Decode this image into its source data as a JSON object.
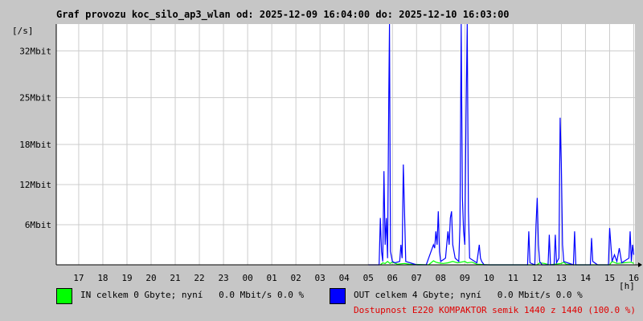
{
  "title": "Graf provozu koc_silo_ap3_wlan od: 2025-12-09 16:04:00 do: 2025-12-10 16:03:00",
  "chart_data": {
    "type": "line",
    "ylabel": "[/s]",
    "xlabel": "[h]",
    "ylim": [
      0,
      36
    ],
    "y_ticks": [
      {
        "value": 6,
        "label": "6Mbit"
      },
      {
        "value": 12,
        "label": "12Mbit"
      },
      {
        "value": 18,
        "label": "18Mbit"
      },
      {
        "value": 25,
        "label": "25Mbit"
      },
      {
        "value": 32,
        "label": "32Mbit"
      }
    ],
    "x_ticks": [
      "17",
      "18",
      "19",
      "20",
      "21",
      "22",
      "23",
      "00",
      "01",
      "02",
      "03",
      "04",
      "05",
      "06",
      "07",
      "08",
      "09",
      "10",
      "11",
      "12",
      "13",
      "14",
      "15",
      "16"
    ],
    "x_range_hours": [
      16.07,
      40.05
    ],
    "grid": true,
    "series": [
      {
        "name": "IN",
        "color": "#00ff00",
        "points": [
          [
            29.5,
            0
          ],
          [
            29.6,
            0.3
          ],
          [
            29.7,
            0.2
          ],
          [
            29.8,
            0.5
          ],
          [
            29.9,
            0.2
          ],
          [
            30.0,
            0.4
          ],
          [
            30.2,
            0.1
          ],
          [
            30.5,
            0.2
          ],
          [
            30.7,
            0.1
          ],
          [
            31.5,
            0
          ],
          [
            31.6,
            0.3
          ],
          [
            31.7,
            0.6
          ],
          [
            31.8,
            0.4
          ],
          [
            31.9,
            0.3
          ],
          [
            32.1,
            0.2
          ],
          [
            32.3,
            0.3
          ],
          [
            32.5,
            0.5
          ],
          [
            32.7,
            0.3
          ],
          [
            33.0,
            0.5
          ],
          [
            33.1,
            0.3
          ],
          [
            33.3,
            0.4
          ],
          [
            33.5,
            0.1
          ],
          [
            34.0,
            0
          ],
          [
            36.0,
            0
          ],
          [
            36.1,
            0.3
          ],
          [
            36.3,
            0.2
          ],
          [
            36.5,
            0
          ],
          [
            37.0,
            0.2
          ],
          [
            37.1,
            0.4
          ],
          [
            37.2,
            0.1
          ],
          [
            37.5,
            0
          ],
          [
            39.0,
            0
          ],
          [
            39.1,
            0.5
          ],
          [
            39.3,
            0.2
          ],
          [
            39.6,
            0.3
          ],
          [
            39.9,
            0.4
          ],
          [
            40.0,
            0.2
          ]
        ]
      },
      {
        "name": "OUT",
        "color": "#0000ff",
        "points": [
          [
            29.0,
            0
          ],
          [
            29.45,
            0
          ],
          [
            29.5,
            7
          ],
          [
            29.55,
            2
          ],
          [
            29.6,
            0.5
          ],
          [
            29.65,
            14
          ],
          [
            29.7,
            3
          ],
          [
            29.75,
            7
          ],
          [
            29.8,
            1
          ],
          [
            29.85,
            25
          ],
          [
            29.88,
            36
          ],
          [
            29.92,
            2
          ],
          [
            30.0,
            0.5
          ],
          [
            30.1,
            0.3
          ],
          [
            30.3,
            0.5
          ],
          [
            30.35,
            3
          ],
          [
            30.4,
            1
          ],
          [
            30.45,
            15
          ],
          [
            30.5,
            8
          ],
          [
            30.55,
            0.5
          ],
          [
            31.0,
            0
          ],
          [
            31.4,
            0
          ],
          [
            31.5,
            1
          ],
          [
            31.6,
            2
          ],
          [
            31.7,
            3
          ],
          [
            31.75,
            2.5
          ],
          [
            31.8,
            5
          ],
          [
            31.85,
            3
          ],
          [
            31.9,
            8
          ],
          [
            31.95,
            2
          ],
          [
            32.0,
            0.5
          ],
          [
            32.2,
            1
          ],
          [
            32.3,
            5
          ],
          [
            32.35,
            3
          ],
          [
            32.4,
            7
          ],
          [
            32.45,
            8
          ],
          [
            32.5,
            3
          ],
          [
            32.55,
            2
          ],
          [
            32.6,
            1
          ],
          [
            32.75,
            0.5
          ],
          [
            32.8,
            6
          ],
          [
            32.85,
            36
          ],
          [
            32.9,
            10
          ],
          [
            32.95,
            5
          ],
          [
            33.0,
            3
          ],
          [
            33.05,
            22
          ],
          [
            33.1,
            36
          ],
          [
            33.15,
            8
          ],
          [
            33.2,
            1
          ],
          [
            33.5,
            0.3
          ],
          [
            33.6,
            3
          ],
          [
            33.65,
            1
          ],
          [
            33.7,
            0.5
          ],
          [
            33.8,
            0
          ],
          [
            35.0,
            0
          ],
          [
            35.6,
            0
          ],
          [
            35.65,
            5
          ],
          [
            35.7,
            0.3
          ],
          [
            35.9,
            0
          ],
          [
            35.95,
            6
          ],
          [
            36.0,
            10
          ],
          [
            36.05,
            3
          ],
          [
            36.1,
            0.5
          ],
          [
            36.2,
            0
          ],
          [
            36.45,
            0
          ],
          [
            36.5,
            4.5
          ],
          [
            36.55,
            0
          ],
          [
            36.7,
            0
          ],
          [
            36.75,
            4.5
          ],
          [
            36.8,
            0.3
          ],
          [
            36.9,
            1
          ],
          [
            36.95,
            22
          ],
          [
            37.0,
            15
          ],
          [
            37.05,
            3
          ],
          [
            37.1,
            0.5
          ],
          [
            37.5,
            0
          ],
          [
            37.55,
            5
          ],
          [
            37.6,
            0
          ],
          [
            38.2,
            0
          ],
          [
            38.25,
            4
          ],
          [
            38.3,
            0.5
          ],
          [
            38.5,
            0
          ],
          [
            38.95,
            0
          ],
          [
            39.0,
            5.5
          ],
          [
            39.05,
            3
          ],
          [
            39.1,
            0.5
          ],
          [
            39.2,
            1.5
          ],
          [
            39.3,
            0.5
          ],
          [
            39.4,
            2.5
          ],
          [
            39.5,
            0.3
          ],
          [
            39.8,
            1
          ],
          [
            39.85,
            5
          ],
          [
            39.9,
            0.5
          ],
          [
            39.95,
            3
          ],
          [
            40.0,
            1.5
          ]
        ]
      }
    ]
  },
  "legend": {
    "in_text": "IN celkem 0 Gbyte; nyní   0.0 Mbit/s 0.0 %",
    "out_text": "OUT celkem 4 Gbyte; nyní   0.0 Mbit/s 0.0 %",
    "availability": "Dostupnost E220 KOMPAKTOR semik 1440 z 1440 (100.0 %)"
  }
}
